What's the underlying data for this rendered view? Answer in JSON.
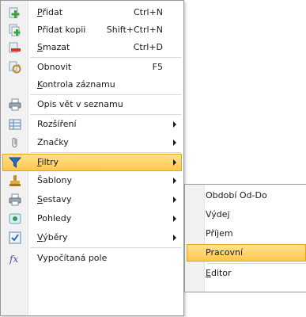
{
  "menu": {
    "items": [
      {
        "label": "Přidat",
        "ul": "P",
        "rest": "řidat",
        "shortcut": "Ctrl+N",
        "icon": "add-icon",
        "submenu": false
      },
      {
        "label": "Přidat kopii",
        "ul": "",
        "rest": "Přidat kopii",
        "shortcut": "Shift+Ctrl+N",
        "icon": "add-copy-icon",
        "submenu": false
      },
      {
        "label": "Smazat",
        "ul": "S",
        "rest": "mazat",
        "shortcut": "Ctrl+D",
        "icon": "delete-icon",
        "submenu": false
      },
      {
        "label": "Obnovit",
        "ul": "",
        "rest": "Obnovit",
        "shortcut": "F5",
        "icon": "refresh-icon",
        "submenu": false
      },
      {
        "label": "Kontrola záznamu",
        "ul": "K",
        "rest": "ontrola záznamu",
        "shortcut": "",
        "icon": "",
        "submenu": false
      },
      {
        "label": "Opis vět v seznamu",
        "ul": "",
        "rest": "Opis vět v seznamu",
        "shortcut": "",
        "icon": "printer-icon",
        "submenu": false
      },
      {
        "label": "Rozšíření",
        "ul": "",
        "rest": "Rozšíření",
        "shortcut": "",
        "icon": "grid-icon",
        "submenu": true
      },
      {
        "label": "Značky",
        "ul": "",
        "rest": "Značky",
        "shortcut": "",
        "icon": "paperclip-icon",
        "submenu": true
      },
      {
        "label": "Filtry",
        "ul": "F",
        "rest": "iltry",
        "shortcut": "",
        "icon": "filter-icon",
        "submenu": true,
        "highlighted": true
      },
      {
        "label": "Šablony",
        "ul": "",
        "rest": "Šablony",
        "shortcut": "",
        "icon": "stamp-icon",
        "submenu": true
      },
      {
        "label": "Sestavy",
        "ul": "S",
        "rest": "estavy",
        "shortcut": "",
        "icon": "printer-icon",
        "submenu": true
      },
      {
        "label": "Pohledy",
        "ul": "",
        "rest": "Pohledy",
        "shortcut": "",
        "icon": "view-icon",
        "submenu": true
      },
      {
        "label": "Výběry",
        "ul": "V",
        "rest": "ýběry",
        "shortcut": "",
        "icon": "checkbox-icon",
        "submenu": true
      },
      {
        "label": "Vypočítaná pole",
        "ul": "",
        "rest": "Vypočítaná pole",
        "shortcut": "",
        "icon": "formula-icon",
        "submenu": false
      }
    ]
  },
  "submenu": {
    "items": [
      {
        "label": "Období Od-Do"
      },
      {
        "label": "Výdej"
      },
      {
        "label": "Příjem"
      },
      {
        "label": "Pracovní",
        "highlighted": true
      },
      {
        "label": "Editor"
      }
    ]
  },
  "colors": {
    "highlight_top": "#ffe28f",
    "highlight_bottom": "#ffc74d",
    "highlight_border": "#e6a41c",
    "gutter": "#f1f1f1"
  }
}
